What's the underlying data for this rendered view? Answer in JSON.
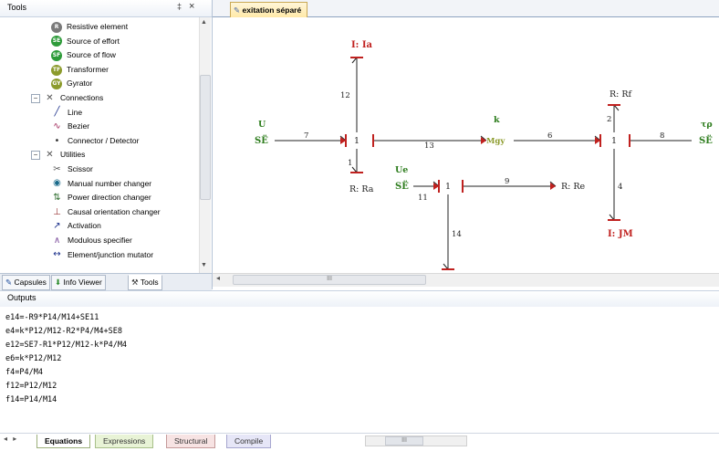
{
  "tools": {
    "title": "Tools",
    "pin": "‡",
    "close": "×",
    "items": [
      {
        "label": "Resistive element",
        "icon": "resistive-element-icon",
        "glyph": "R",
        "color": "#7a7a7a",
        "level": 2
      },
      {
        "label": "Source of effort",
        "icon": "source-of-effort-icon",
        "glyph": "SE",
        "color": "#2e9b3a",
        "level": 2
      },
      {
        "label": "Source of flow",
        "icon": "source-of-flow-icon",
        "glyph": "SF",
        "color": "#2e9b3a",
        "level": 2
      },
      {
        "label": "Transformer",
        "icon": "transformer-icon",
        "glyph": "TF",
        "color": "#8c9b2c",
        "level": 2
      },
      {
        "label": "Gyrator",
        "icon": "gyrator-icon",
        "glyph": "GY",
        "color": "#8c9b2c",
        "level": 2
      },
      {
        "label": "Connections",
        "icon": "connections-icon",
        "glyph": "✕",
        "color": "#555555",
        "level": 1
      },
      {
        "label": "Line",
        "icon": "line-icon",
        "glyph": "╱",
        "color": "#1a2f8a",
        "level": 2
      },
      {
        "label": "Bezier",
        "icon": "bezier-icon",
        "glyph": "∿",
        "color": "#a0285a",
        "level": 2
      },
      {
        "label": "Connector / Detector",
        "icon": "connector-detector-icon",
        "glyph": "•",
        "color": "#333333",
        "level": 2
      },
      {
        "label": "Utilities",
        "icon": "utilities-icon",
        "glyph": "✕",
        "color": "#555555",
        "level": 1
      },
      {
        "label": "Scissor",
        "icon": "scissor-icon",
        "glyph": "✂",
        "color": "#555555",
        "level": 2
      },
      {
        "label": "Manual number changer",
        "icon": "manual-number-changer-icon",
        "glyph": "◉",
        "color": "#1a6a8a",
        "level": 2
      },
      {
        "label": "Power direction changer",
        "icon": "power-direction-changer-icon",
        "glyph": "⇅",
        "color": "#2a6a2a",
        "level": 2
      },
      {
        "label": "Causal orientation changer",
        "icon": "causal-orientation-changer-icon",
        "glyph": "⊥",
        "color": "#9a3a3a",
        "level": 2
      },
      {
        "label": "Activation",
        "icon": "activation-icon",
        "glyph": "↗",
        "color": "#1a2f8a",
        "level": 2
      },
      {
        "label": "Modulous specifier",
        "icon": "modulous-specifier-icon",
        "glyph": "∧",
        "color": "#7a4a9a",
        "level": 2
      },
      {
        "label": "Element/junction mutator",
        "icon": "element-junction-mutator-icon",
        "glyph": "↔",
        "color": "#1a2f8a",
        "level": 2
      }
    ],
    "tabs": [
      {
        "label": "Capsules",
        "icon": "capsules-icon",
        "glyph": "✎"
      },
      {
        "label": "Info Viewer",
        "icon": "info-viewer-icon",
        "glyph": "⬇"
      },
      {
        "label": "Tools",
        "icon": "tools-icon",
        "glyph": "⚒"
      }
    ]
  },
  "document": {
    "tab_label": "exitation séparé",
    "scroll_mark": "III"
  },
  "diagram": {
    "labels": {
      "I_Ia": "I: Ia",
      "R_Rf": "R: Rf",
      "U": "U",
      "SE_left": "SË",
      "k": "k",
      "MGY": "Mgy",
      "tau": "τρ",
      "SE_right": "SË",
      "R_Ra": "R: Ra",
      "Ue": "Ue",
      "SE_mid": "SË",
      "R_Re": "R: Re",
      "I_JM": "I: JM",
      "j1": "1",
      "j2": "1",
      "j3": "1",
      "b7": "7",
      "b13": "13",
      "b6": "6",
      "b8": "8",
      "b12": "12",
      "b1": "1",
      "b2": "2",
      "b4": "4",
      "b11": "11",
      "b9": "9",
      "b14": "14"
    },
    "colors": {
      "effort": "#2e7d1e",
      "inertia": "#c0211f",
      "bond": "#222222",
      "flow": "#000000"
    }
  },
  "outputs": {
    "title": "Outputs",
    "equations": [
      "e14=-R9*P14/M14+SE11",
      "e4=k*P12/M12-R2*P4/M4+SE8",
      "e12=SE7-R1*P12/M12-k*P4/M4",
      "e6=k*P12/M12",
      "f4=P4/M4",
      "f12=P12/M12",
      "f14=P14/M14"
    ]
  },
  "bottom_tabs": {
    "equations": "Equations",
    "expressions": "Expressions",
    "structural": "Structural",
    "compile": "Compile",
    "nav": "◂ ▸",
    "scroll_mark": "III"
  }
}
